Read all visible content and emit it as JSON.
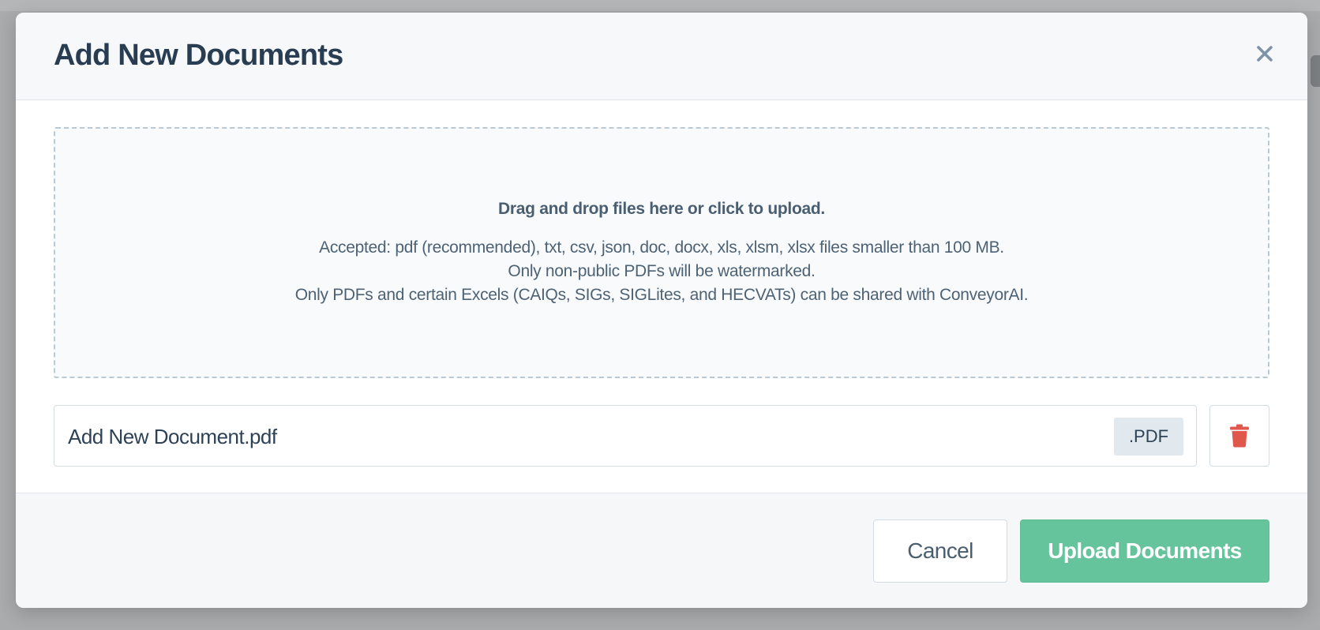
{
  "modal": {
    "title": "Add New Documents",
    "close_icon": "close-icon"
  },
  "dropzone": {
    "title": "Drag and drop files here or click to upload.",
    "lines": [
      "Accepted: pdf (recommended), txt, csv, json, doc, docx, xls, xlsm, xlsx files smaller than 100 MB.",
      "Only non-public PDFs will be watermarked.",
      "Only PDFs and certain Excels (CAIQs, SIGs, SIGLites, and HECVATs) can be shared with ConveyorAI."
    ]
  },
  "file": {
    "name": "Add New Document.pdf",
    "extension": ".PDF",
    "delete_icon": "trash-icon"
  },
  "footer": {
    "cancel_label": "Cancel",
    "upload_label": "Upload Documents"
  },
  "colors": {
    "primary_green": "#66c49d",
    "danger_red": "#e0584c",
    "title_text": "#283c52"
  }
}
